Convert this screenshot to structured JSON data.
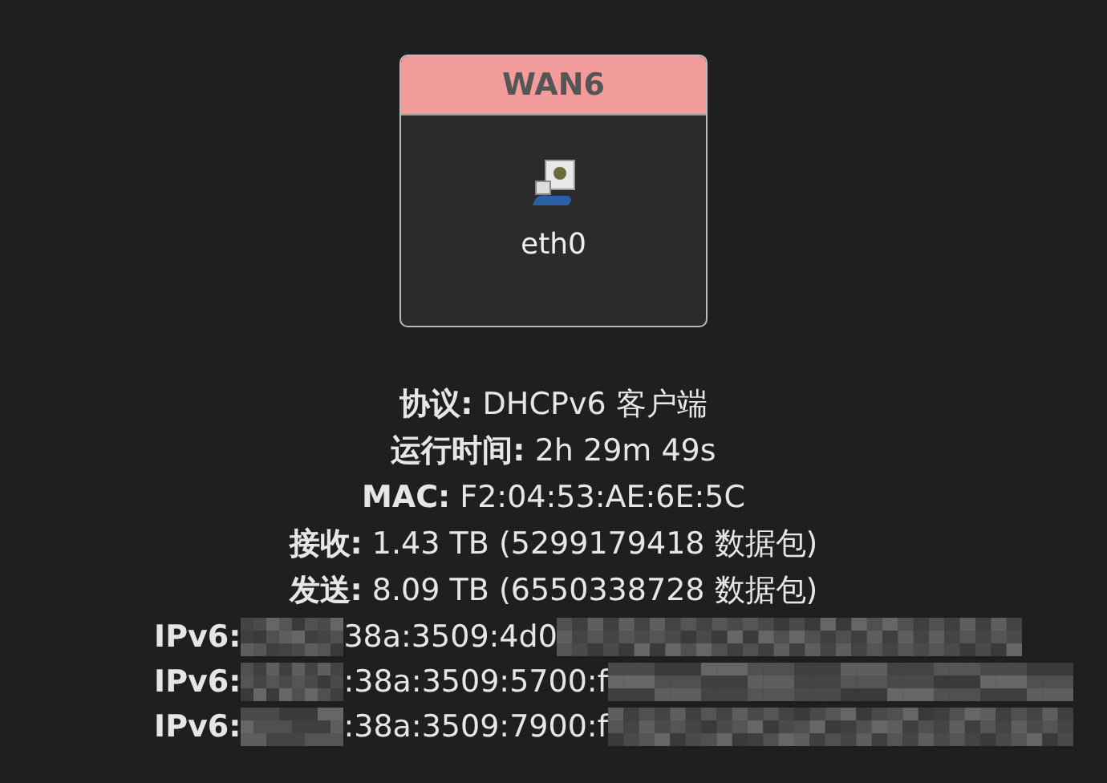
{
  "card": {
    "title": "WAN6",
    "device": "eth0"
  },
  "info": [
    {
      "label": "协议:",
      "value": "DHCPv6 客户端"
    },
    {
      "label": "运行时间:",
      "value": "2h 29m 49s"
    },
    {
      "label": "MAC:",
      "value": "F2:04:53:AE:6E:5C"
    },
    {
      "label": "接收:",
      "value": "1.43 TB (5299179418 数据包)"
    },
    {
      "label": "发送:",
      "value": "8.09 TB (6550338728 数据包)"
    }
  ],
  "addresses": [
    {
      "label": "IPv6:",
      "value": "38a:3509:4d0"
    },
    {
      "label": "IPv6:",
      "value": ":38a:3509:5700:f"
    },
    {
      "label": "IPv6:",
      "value": ":38a:3509:7900:f"
    }
  ]
}
